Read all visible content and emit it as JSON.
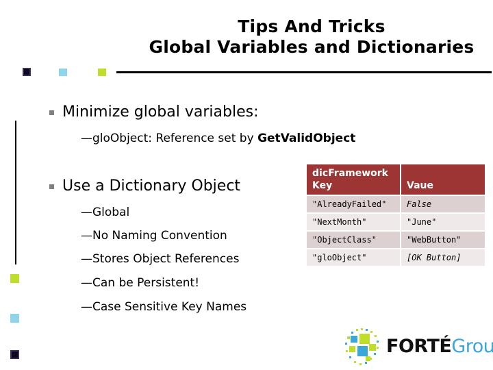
{
  "slide": {
    "title_line1": "Tips And Tricks",
    "title_line2": "Global Variables and Dictionaries"
  },
  "content": {
    "bullet1": {
      "text": "Minimize global variables:",
      "sub": [
        {
          "prefix": "gloObject: Reference set by ",
          "emphasis": "GetValidObject"
        }
      ]
    },
    "bullet2": {
      "text": "Use a Dictionary Object",
      "sub": [
        {
          "text": "Global"
        },
        {
          "text": "No Naming Convention"
        },
        {
          "text": "Stores Object References"
        },
        {
          "text": "Can be Persistent!"
        },
        {
          "text": "Case Sensitive Key Names"
        }
      ]
    }
  },
  "table": {
    "caption": "dicFramework",
    "headers": [
      "Key",
      "Vaue"
    ],
    "rows": [
      {
        "key": "\"AlreadyFailed\"",
        "value": "False",
        "value_italic": true
      },
      {
        "key": "\"NextMonth\"",
        "value": "\"June\"",
        "value_italic": false
      },
      {
        "key": "\"ObjectClass\"",
        "value": "\"WebButton\"",
        "value_italic": false
      },
      {
        "key": "\"gloObject\"",
        "value": "[OK Button]",
        "value_italic": true
      }
    ]
  },
  "logo": {
    "name_bold": "FORTÉ",
    "name_light": "Group"
  },
  "colors": {
    "table_header_bg": "#9e3535",
    "row_dark": "#ddd0d0",
    "row_light": "#efe9e9",
    "deco_green": "#bede2a",
    "deco_blue": "#8fd4e8",
    "deco_navy": "#100820",
    "logo_blue": "#3ba6d8"
  }
}
